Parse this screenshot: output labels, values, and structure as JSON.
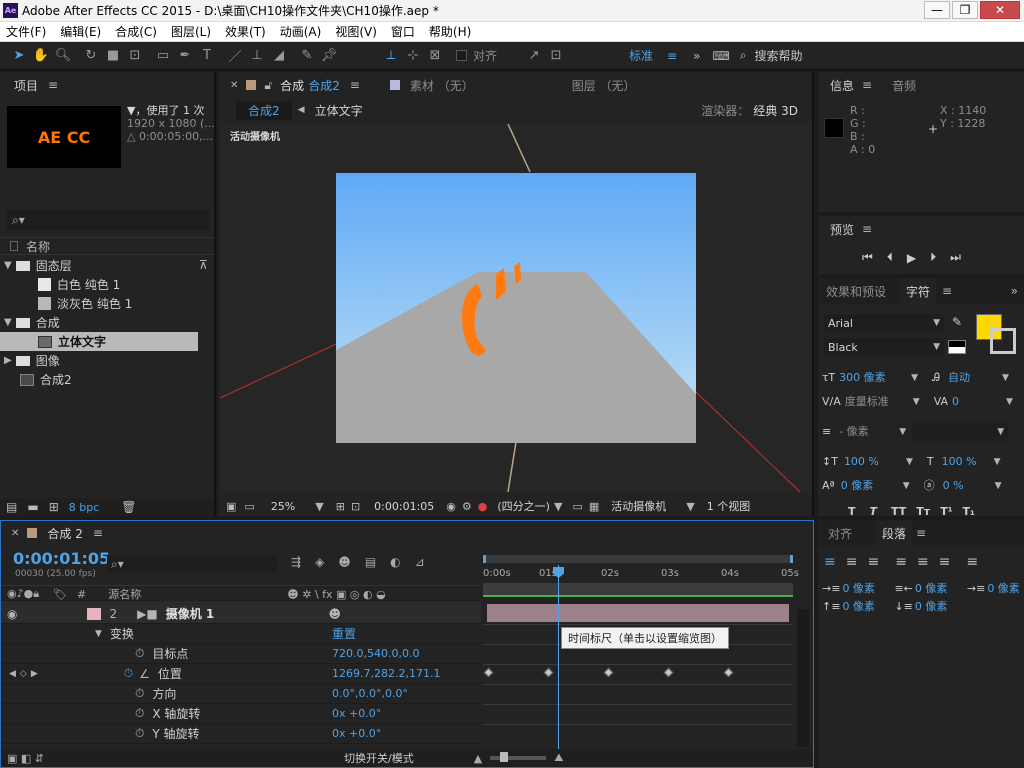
{
  "window": {
    "title": "Adobe After Effects CC 2015 - D:\\桌面\\CH10操作文件夹\\CH10操作.aep *",
    "app_icon": "Ae"
  },
  "menu": [
    "文件(F)",
    "编辑(E)",
    "合成(C)",
    "图层(L)",
    "效果(T)",
    "动画(A)",
    "视图(V)",
    "窗口",
    "帮助(H)"
  ],
  "toolbar": {
    "snap_label": "对齐",
    "workspace": "标准",
    "search_placeholder": "搜索帮助"
  },
  "project": {
    "tab": "项目",
    "preview_logo": "AE CC",
    "info_line1": "▼，使用了 1 次",
    "info_line2": "1920 x 1080 (...",
    "info_line3": "△ 0:00:05:00,...",
    "col_name": "名称",
    "tree": [
      {
        "label": "固态层",
        "type": "folder",
        "level": 0
      },
      {
        "label": "白色 纯色 1",
        "type": "solid",
        "level": 1
      },
      {
        "label": "淡灰色 纯色 1",
        "type": "solid",
        "level": 1
      },
      {
        "label": "合成",
        "type": "folder",
        "level": 0
      },
      {
        "label": "立体文字",
        "type": "comp",
        "level": 1,
        "selected": true
      },
      {
        "label": "图像",
        "type": "folder",
        "level": 0
      },
      {
        "label": "合成2",
        "type": "comp",
        "level": 0
      }
    ],
    "bpc": "8 bpc"
  },
  "comp_panel": {
    "tab_prefix": "合成",
    "tab_name": "合成2",
    "footage_tab": "素材 （无）",
    "layer_tab": "图层 （无）",
    "breadcrumb_active": "合成2",
    "breadcrumb_next": "立体文字",
    "renderer_label": "渲染器：",
    "renderer_value": "经典 3D",
    "camera_label": "活动摄像机",
    "zoom": "25%",
    "timecode": "0:00:01:05",
    "resolution": "(四分之一)",
    "view_camera": "活动摄像机",
    "views": "1 个视图"
  },
  "info": {
    "tab": "信息",
    "audio_tab": "音频",
    "r": "R :",
    "g": "G :",
    "b": "B :",
    "a": "A : 0",
    "x": "X : 1140",
    "y": "Y : 1228"
  },
  "preview": {
    "tab": "预览"
  },
  "effects": {
    "tab": "效果和预设"
  },
  "character": {
    "tab": "字符",
    "font": "Arial",
    "style": "Black",
    "size": "300 像素",
    "leading": "自动",
    "kerning": "度量标准",
    "tracking": "0",
    "stroke": "- 像素",
    "vscale": "100 %",
    "hscale": "100 %",
    "baseline": "0 像素",
    "tsume": "0 %",
    "fill_color": "#ffd800"
  },
  "paragraph": {
    "align_tab": "对齐",
    "tab": "段落",
    "indent_left": "0 像素",
    "indent_right": "0 像素",
    "first_line": "0 像素",
    "space_before": "0 像素",
    "space_after": "0 像素"
  },
  "timeline": {
    "tab": "合成 2",
    "timecode": "0:00:01:05",
    "fps": "00030 (25.00 fps)",
    "col_num": "#",
    "col_name": "源名称",
    "ruler": [
      "0:00s",
      "01s",
      "02s",
      "03s",
      "04s",
      "05s"
    ],
    "tooltip": "时间标尺（单击以设置缩览图）",
    "toggle_label": "切换开关/模式",
    "layers": [
      {
        "num": "2",
        "name": "摄像机 1",
        "kind": "layer",
        "value": ""
      },
      {
        "name": "变换",
        "kind": "group",
        "value": "重置"
      },
      {
        "name": "目标点",
        "kind": "prop",
        "value": "720.0,540.0,0.0"
      },
      {
        "name": "位置",
        "kind": "prop",
        "value": "1269.7,282.2,171.1",
        "keyed": true
      },
      {
        "name": "方向",
        "kind": "prop",
        "value": "0.0°,0.0°,0.0°"
      },
      {
        "name": "X 轴旋转",
        "kind": "prop",
        "value": "0x +0.0°"
      },
      {
        "name": "Y 轴旋转",
        "kind": "prop",
        "value": "0x +0.0°"
      }
    ]
  }
}
